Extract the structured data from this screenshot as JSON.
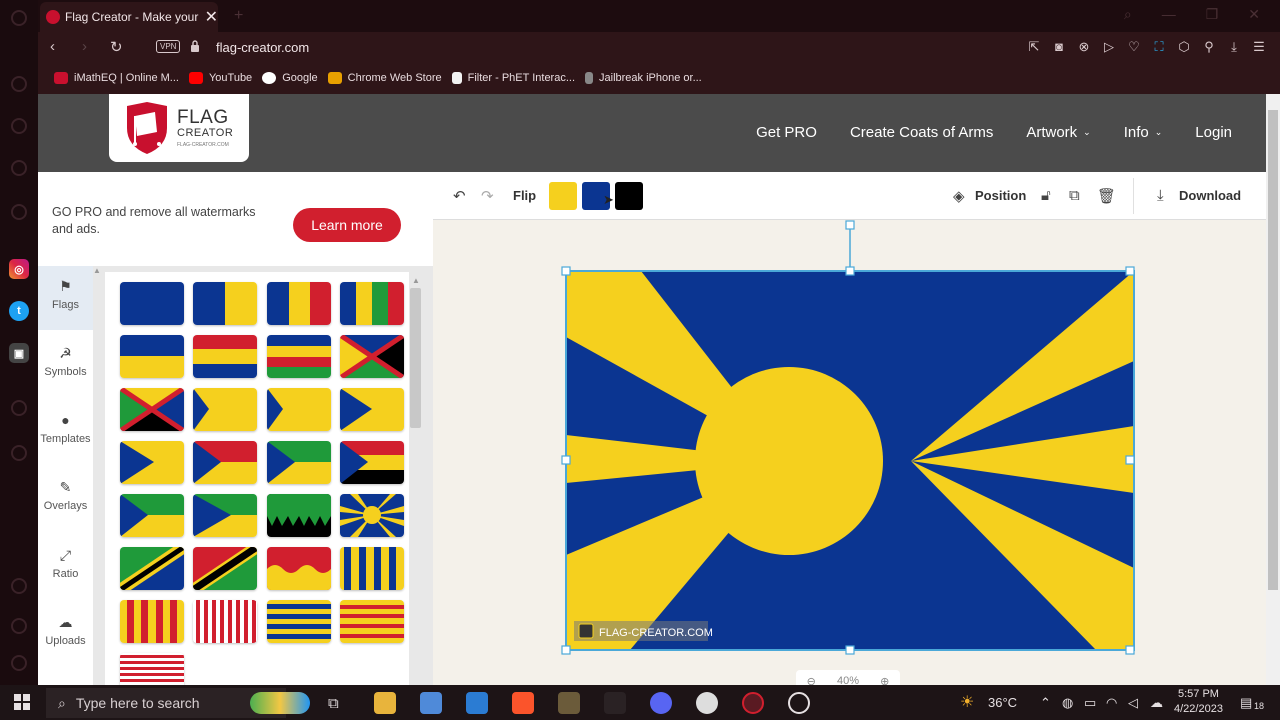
{
  "browser": {
    "tab_title": "Flag Creator - Make your fl",
    "url": "flag-creator.com",
    "vpn_label": "VPN",
    "bookmarks": [
      {
        "label": "iMathEQ | Online M...",
        "color": "#c8102e"
      },
      {
        "label": "YouTube",
        "color": "#ff0000"
      },
      {
        "label": "Google",
        "color": "#ffffff"
      },
      {
        "label": "Chrome Web Store",
        "color": "#e8a000"
      },
      {
        "label": "Filter - PhET Interac...",
        "color": "#f2f2f2"
      },
      {
        "label": "Jailbreak iPhone or...",
        "color": "#888888"
      }
    ]
  },
  "site": {
    "logo_line1": "FLAG",
    "logo_line2": "CREATOR",
    "logo_line3": "FLAG-CREATOR.COM",
    "nav": [
      {
        "label": "Get PRO",
        "dropdown": false
      },
      {
        "label": "Create Coats of Arms",
        "dropdown": false
      },
      {
        "label": "Artwork",
        "dropdown": true
      },
      {
        "label": "Info",
        "dropdown": true
      },
      {
        "label": "Login",
        "dropdown": false
      }
    ]
  },
  "promo": {
    "text": "GO PRO and remove all watermarks and ads.",
    "button": "Learn more"
  },
  "categories": [
    {
      "label": "Flags",
      "icon": "flag-icon",
      "active": true
    },
    {
      "label": "Symbols",
      "icon": "hammer-sickle-icon",
      "active": false
    },
    {
      "label": "Templates",
      "icon": "globe-icon",
      "active": false
    },
    {
      "label": "Overlays",
      "icon": "magic-wand-icon",
      "active": false
    },
    {
      "label": "Ratio",
      "icon": "resize-icon",
      "active": false
    },
    {
      "label": "Uploads",
      "icon": "upload-icon",
      "active": false
    }
  ],
  "toolbar": {
    "flip_label": "Flip",
    "position_label": "Position",
    "download_label": "Download",
    "swatches": [
      "#f5d01e",
      "#0b3591",
      "#000000"
    ]
  },
  "flag": {
    "colors": {
      "yellow": "#f5d01e",
      "blue": "#0b3591"
    },
    "watermark": "FLAG-CREATOR.COM"
  },
  "zoom": {
    "value": "40%"
  },
  "taskbar": {
    "search_placeholder": "Type here to search",
    "temperature": "36°C",
    "time": "5:57 PM",
    "date": "4/22/2023",
    "notification_count": "18"
  }
}
